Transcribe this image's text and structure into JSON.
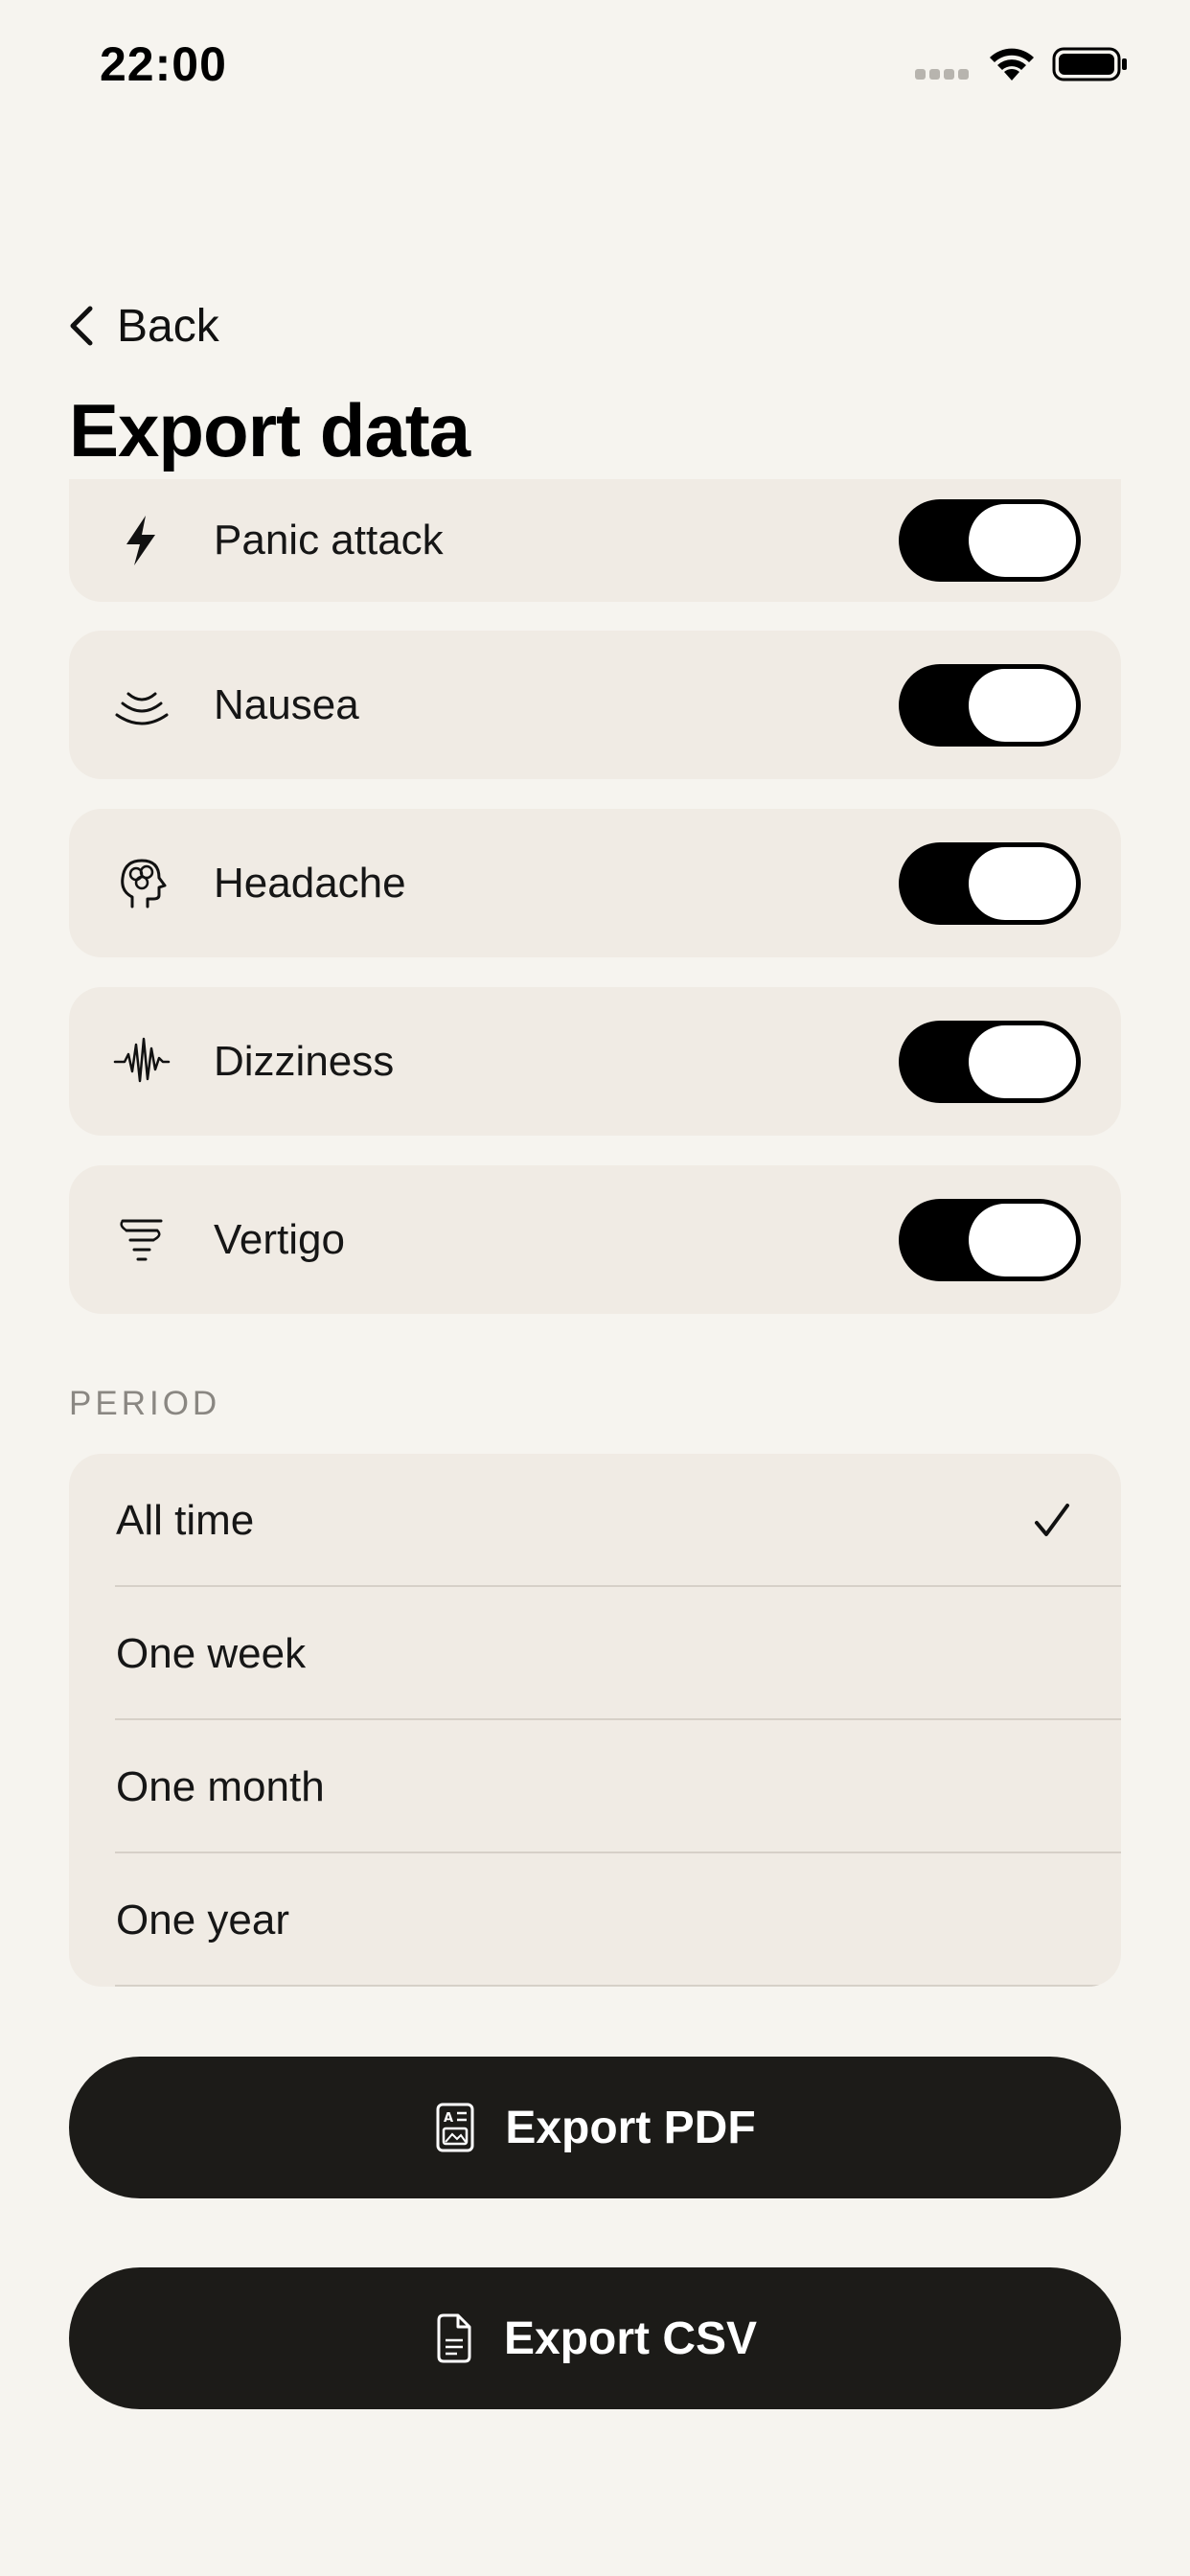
{
  "status_bar": {
    "time": "22:00"
  },
  "nav": {
    "back_label": "Back",
    "title": "Export data"
  },
  "symptoms": [
    {
      "label": "Panic attack",
      "icon": "lightning-icon",
      "enabled": true
    },
    {
      "label": "Nausea",
      "icon": "nausea-waves-icon",
      "enabled": true
    },
    {
      "label": "Headache",
      "icon": "head-brain-icon",
      "enabled": true
    },
    {
      "label": "Dizziness",
      "icon": "waveform-icon",
      "enabled": true
    },
    {
      "label": "Vertigo",
      "icon": "tornado-icon",
      "enabled": true
    }
  ],
  "period": {
    "header": "PERIOD",
    "options": [
      {
        "label": "All time",
        "selected": true
      },
      {
        "label": "One week",
        "selected": false
      },
      {
        "label": "One month",
        "selected": false
      },
      {
        "label": "One year",
        "selected": false
      }
    ]
  },
  "actions": {
    "export_pdf_label": "Export PDF",
    "export_csv_label": "Export CSV"
  },
  "colors": {
    "background": "#f6f4ef",
    "card": "#f0ebe4",
    "button": "#1c1b18",
    "toggle_on": "#000000"
  }
}
